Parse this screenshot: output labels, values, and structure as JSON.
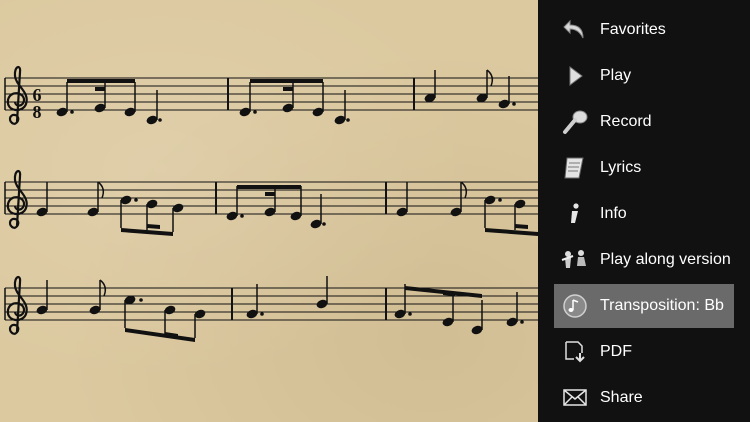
{
  "sheet": {
    "time_signature_top": "6",
    "time_signature_bottom": "8"
  },
  "menu": {
    "items": [
      {
        "label": "Favorites",
        "icon": "favorites-back-arrow-icon"
      },
      {
        "label": "Play",
        "icon": "play-icon"
      },
      {
        "label": "Record",
        "icon": "microphone-icon"
      },
      {
        "label": "Lyrics",
        "icon": "scroll-icon"
      },
      {
        "label": "Info",
        "icon": "info-icon"
      },
      {
        "label": "Play along version",
        "icon": "band-icon"
      },
      {
        "label": "Transposition: Bb",
        "icon": "transposition-icon",
        "selected": true
      },
      {
        "label": "PDF",
        "icon": "pdf-download-icon"
      },
      {
        "label": "Share",
        "icon": "envelope-icon"
      }
    ]
  },
  "colors": {
    "menu_background": "#111111",
    "selected_background": "#6a6a6a",
    "paper": "#dcc9a0",
    "ink": "#111111"
  }
}
